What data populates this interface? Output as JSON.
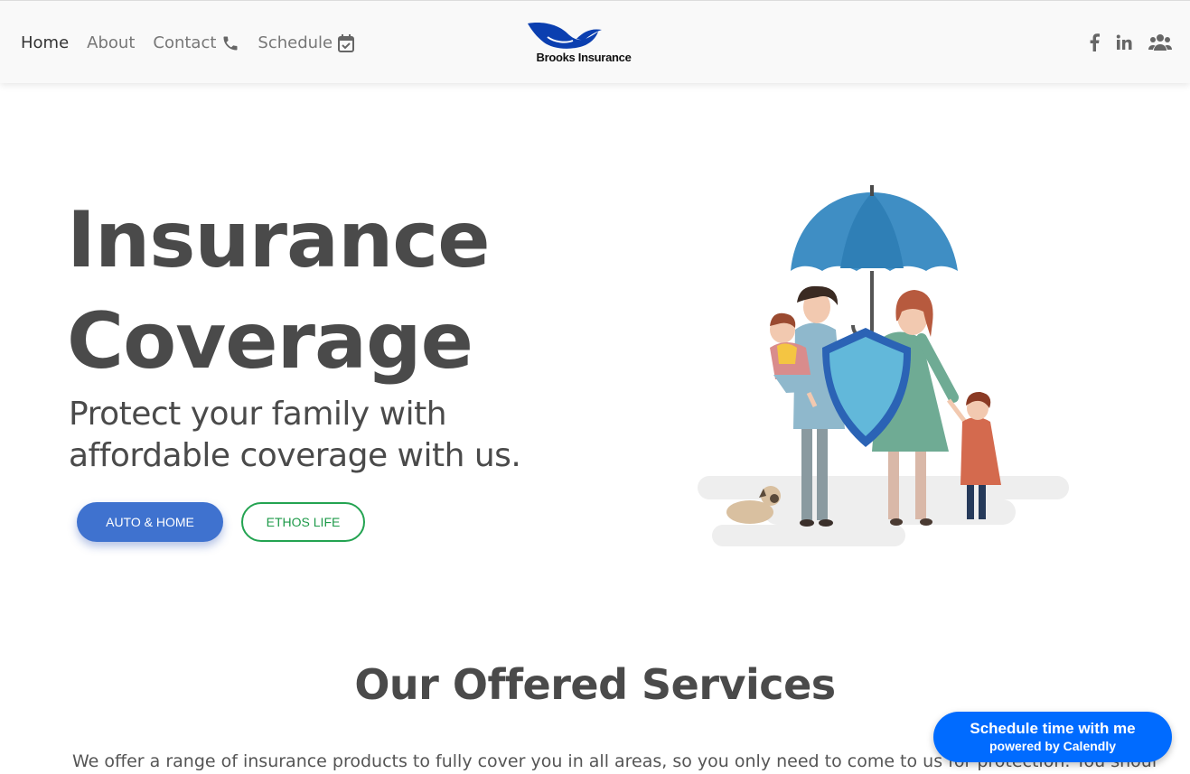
{
  "nav": {
    "home": "Home",
    "about": "About",
    "contact": "Contact",
    "schedule": "Schedule"
  },
  "logo": {
    "text": "Brooks Insurance"
  },
  "social": {
    "icons": [
      "facebook-icon",
      "linkedin-icon",
      "users-icon"
    ]
  },
  "hero": {
    "title_line1": "Insurance",
    "title_line2": "Coverage",
    "subtitle_line1": "Protect your family with",
    "subtitle_line2": "affordable coverage with us.",
    "btn_primary": "AUTO & HOME",
    "btn_secondary": "ETHOS LIFE"
  },
  "services": {
    "title": "Our Offered Services",
    "text": "We offer a range of insurance products to fully cover you in all areas, so you only need to come to us for protection. You should not"
  },
  "calendly": {
    "line1": "Schedule time with me",
    "line2": "powered by Calendly"
  },
  "colors": {
    "primary": "#3f72cf",
    "outline_green": "#23a351",
    "calendly_blue": "#006bff",
    "text": "#4a4a4a"
  }
}
